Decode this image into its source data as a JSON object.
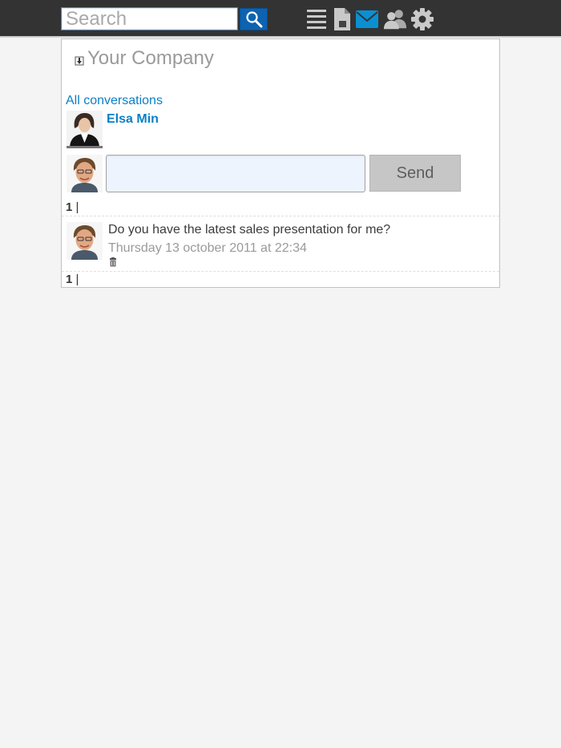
{
  "topbar": {
    "search_placeholder": "Search",
    "search_button_icon": "search-icon",
    "nav_icons": [
      "menu-icon",
      "document-icon",
      "mail-icon",
      "users-icon",
      "settings-icon"
    ],
    "active_icon": "mail-icon",
    "accent_color": "#0b8fd3"
  },
  "panel": {
    "company_name": "Your Company",
    "all_conversations_link": "All conversations",
    "contact_name": "Elsa Min",
    "message_input_value": "",
    "send_label": "Send",
    "pager_top": {
      "page": "1",
      "separator": "|"
    },
    "messages": [
      {
        "text": "Do you have the latest sales presentation for me?",
        "timestamp": "Thursday 13 october 2011 at 22:34"
      }
    ],
    "pager_bottom": {
      "page": "1",
      "separator": "|"
    }
  },
  "colors": {
    "link": "#0b7fc7",
    "topbar": "#333333",
    "send_button": "#c6c6c6"
  }
}
